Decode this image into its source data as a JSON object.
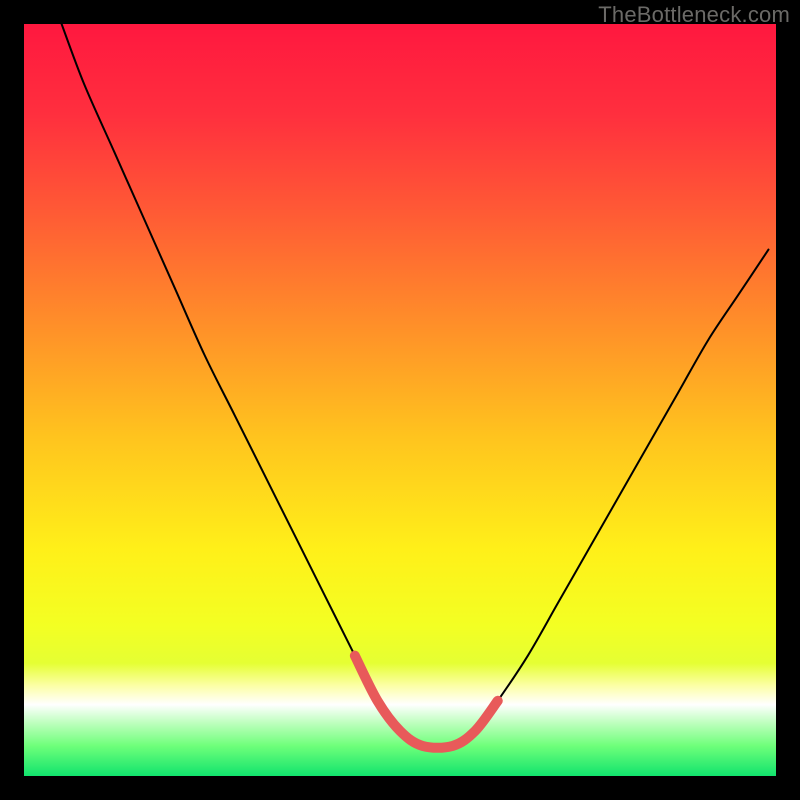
{
  "watermark": "TheBottleneck.com",
  "chart_data": {
    "type": "line",
    "title": "",
    "xlabel": "",
    "ylabel": "",
    "xlim": [
      0,
      100
    ],
    "ylim": [
      0,
      100
    ],
    "grid": false,
    "background_gradient": {
      "type": "vertical",
      "stops": [
        {
          "offset": 0.0,
          "color": "#ff183f"
        },
        {
          "offset": 0.12,
          "color": "#ff2f3e"
        },
        {
          "offset": 0.25,
          "color": "#ff5a35"
        },
        {
          "offset": 0.4,
          "color": "#ff8f29"
        },
        {
          "offset": 0.55,
          "color": "#ffc41e"
        },
        {
          "offset": 0.7,
          "color": "#fff019"
        },
        {
          "offset": 0.8,
          "color": "#f3ff23"
        },
        {
          "offset": 0.85,
          "color": "#e5ff33"
        },
        {
          "offset": 0.88,
          "color": "#fcffa6"
        },
        {
          "offset": 0.905,
          "color": "#ffffff"
        },
        {
          "offset": 0.93,
          "color": "#bcffbc"
        },
        {
          "offset": 0.96,
          "color": "#6eff7a"
        },
        {
          "offset": 1.0,
          "color": "#11e36d"
        }
      ]
    },
    "series": [
      {
        "name": "curve",
        "stroke": "#000000",
        "stroke_width": 2,
        "x": [
          5,
          8,
          12,
          16,
          20,
          24,
          28,
          32,
          36,
          40,
          44,
          47,
          50,
          53,
          57,
          60,
          63,
          67,
          71,
          75,
          79,
          83,
          87,
          91,
          95,
          99
        ],
        "y": [
          100,
          92,
          83,
          74,
          65,
          56,
          48,
          40,
          32,
          24,
          16,
          10,
          6,
          4,
          4,
          6,
          10,
          16,
          23,
          30,
          37,
          44,
          51,
          58,
          64,
          70
        ]
      },
      {
        "name": "base-highlight",
        "stroke": "#e85a5a",
        "stroke_width": 10,
        "linecap": "round",
        "x": [
          44,
          47,
          50,
          53,
          57,
          60,
          63
        ],
        "y": [
          16,
          10,
          6,
          4,
          4,
          6,
          10
        ]
      }
    ]
  }
}
